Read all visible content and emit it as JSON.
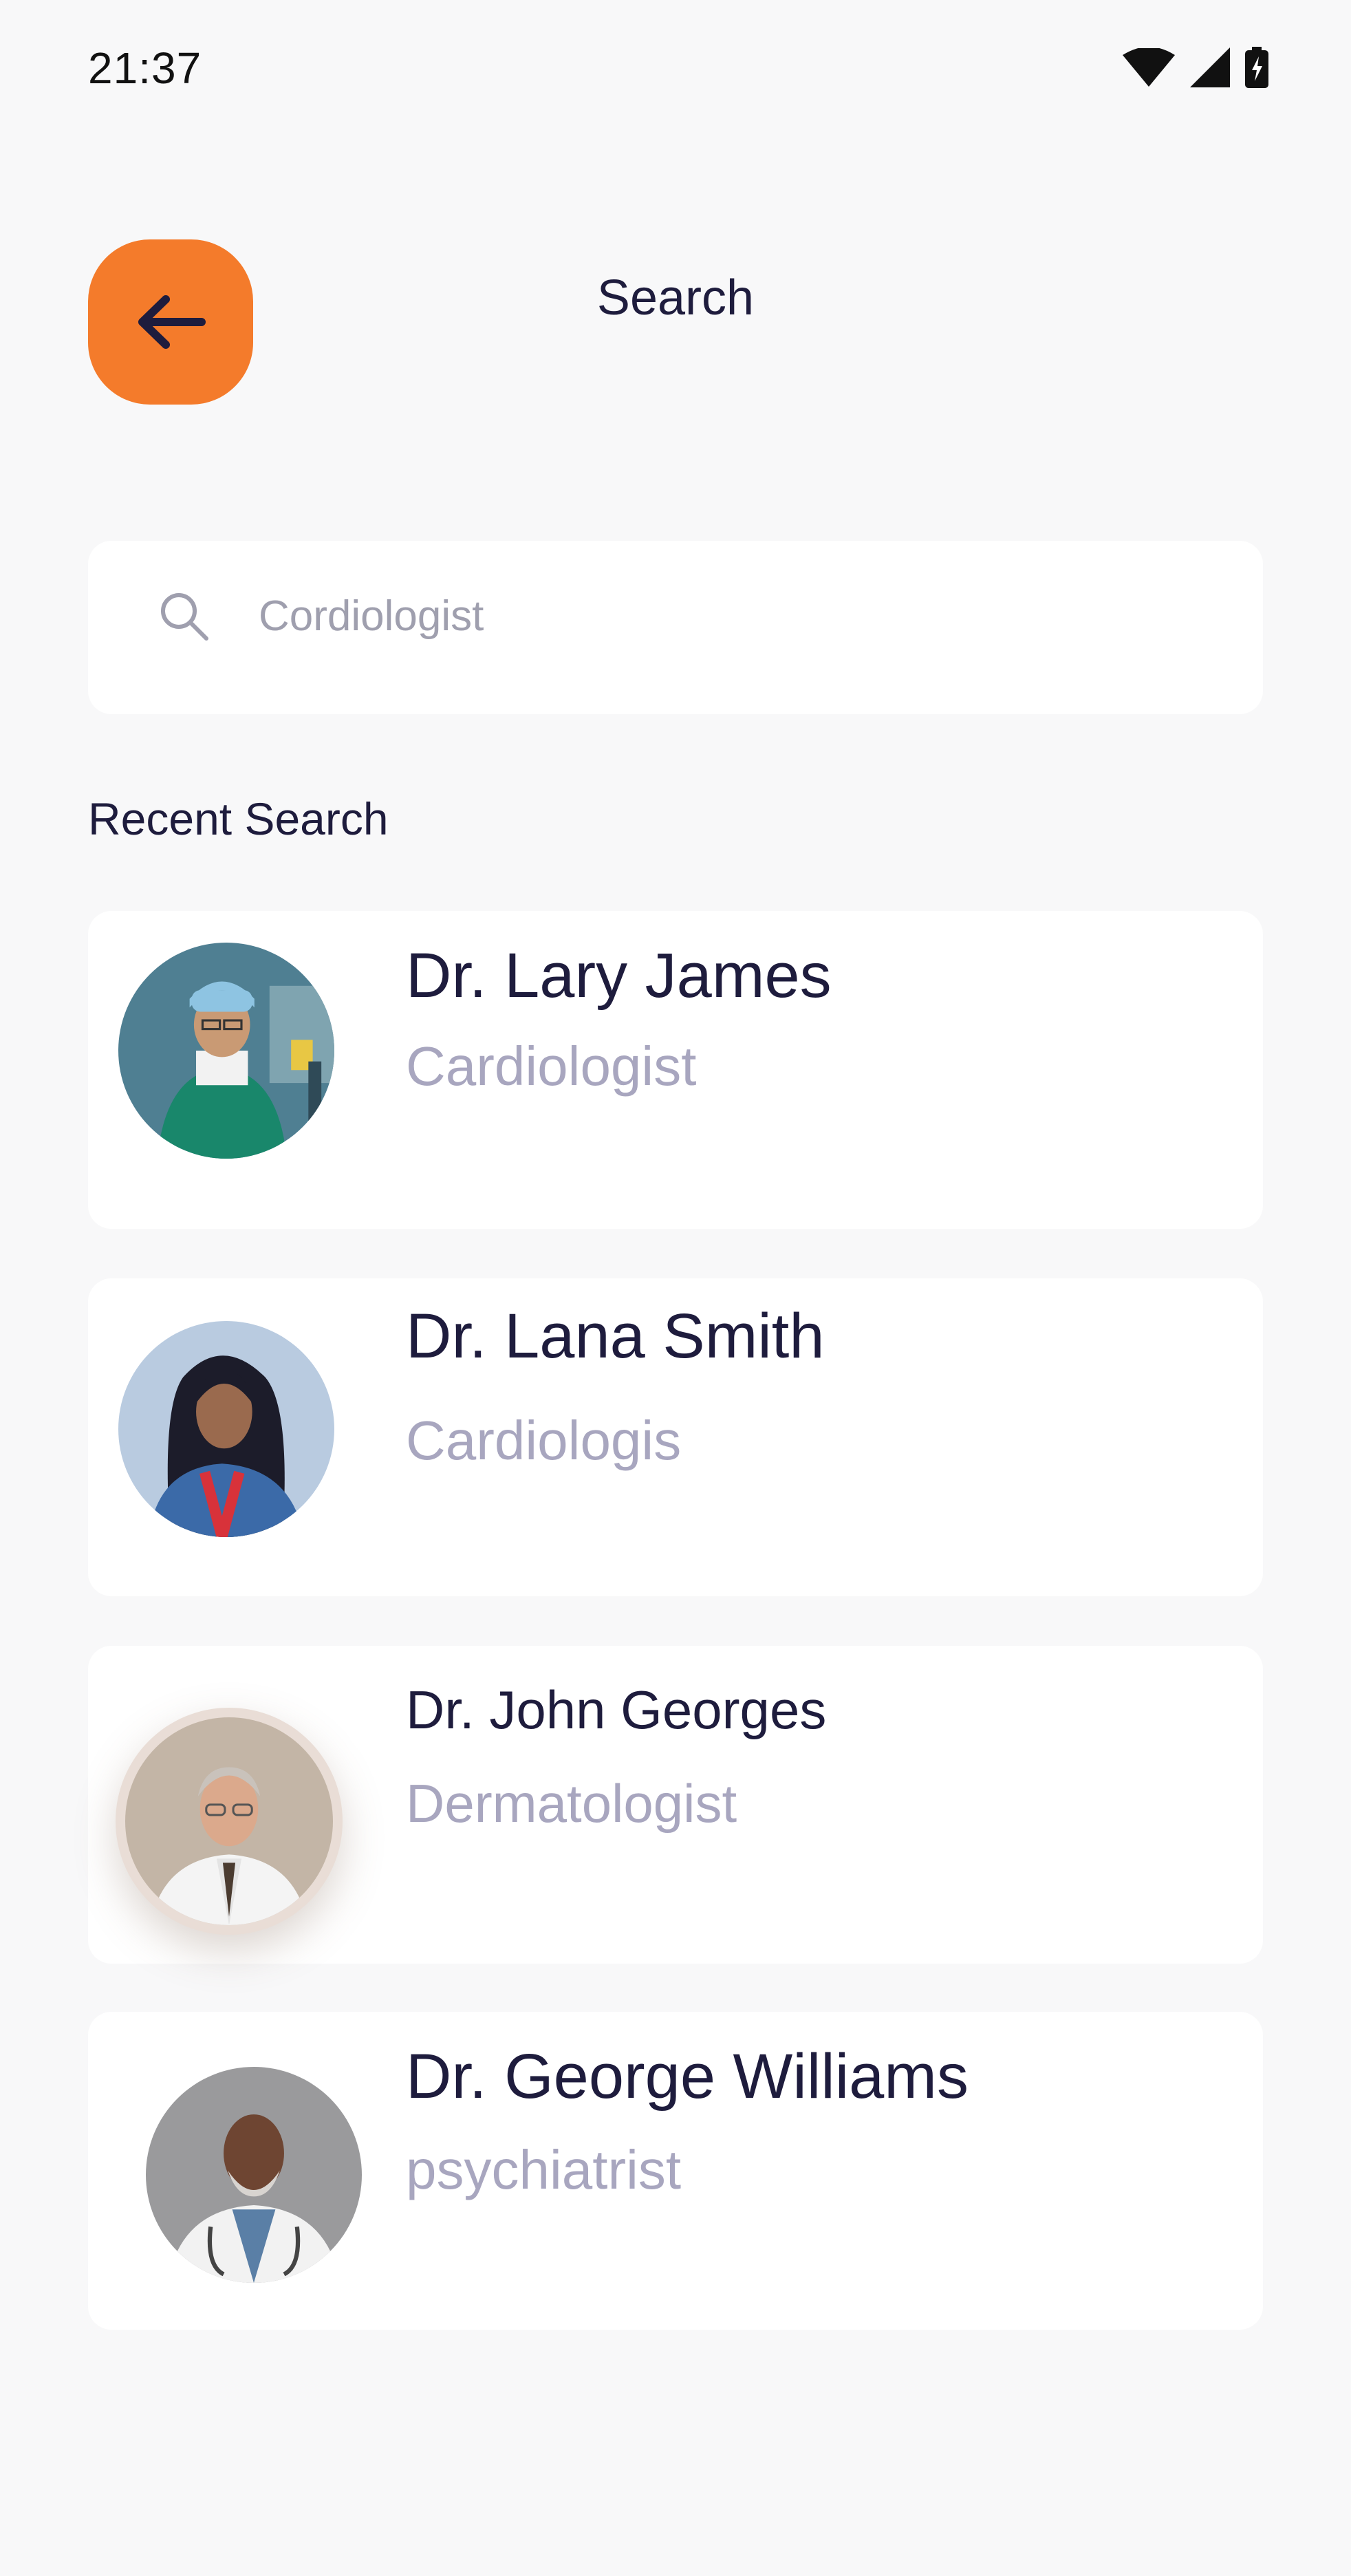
{
  "status_bar": {
    "time": "21:37"
  },
  "header": {
    "title": "Search"
  },
  "search": {
    "placeholder": "Cordiologist"
  },
  "recent": {
    "title": "Recent Search",
    "doctors": [
      {
        "name": "Dr. Lary James",
        "specialty": "Cardiologist"
      },
      {
        "name": "Dr. Lana Smith",
        "specialty": "Cardiologis"
      },
      {
        "name": "Dr. John Georges",
        "specialty": "Dermatologist"
      },
      {
        "name": "Dr. George Williams",
        "specialty": "psychiatrist"
      }
    ]
  },
  "colors": {
    "accent": "#f47b2b",
    "background": "#f8f8f9",
    "card": "#ffffff",
    "text_primary": "#1e1c3d",
    "text_secondary": "#a8a6bf"
  },
  "icons": {
    "back": "arrow-left-icon",
    "search": "search-icon",
    "wifi": "wifi-icon",
    "signal": "signal-icon",
    "battery": "battery-charging-icon"
  }
}
